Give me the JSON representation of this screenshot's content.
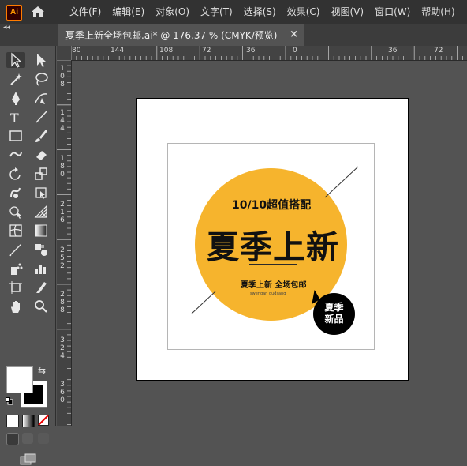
{
  "app": {
    "logo_text": "Ai"
  },
  "menu": [
    "文件(F)",
    "编辑(E)",
    "对象(O)",
    "文字(T)",
    "选择(S)",
    "效果(C)",
    "视图(V)",
    "窗口(W)",
    "帮助(H)"
  ],
  "tab": {
    "title": "夏季上新全场包邮.ai* @ 176.37 % (CMYK/预览)",
    "close": "×",
    "collapse": "◂◂"
  },
  "ruler": {
    "horizontal": [
      "80",
      "144",
      "108",
      "72",
      "36",
      "0",
      "36",
      "72"
    ],
    "vertical": [
      "1\n0\n8",
      "1\n4\n4",
      "1\n8\n0",
      "2\n1\n6",
      "2\n5\n2",
      "2\n8\n8",
      "3\n2\n4",
      "3\n6\n0"
    ]
  },
  "toolbar": {
    "tools": [
      "selection-tool",
      "direct-selection-tool",
      "magic-wand-tool",
      "lasso-tool",
      "pen-tool",
      "curvature-tool",
      "type-tool",
      "line-tool",
      "rectangle-tool",
      "paintbrush-tool",
      "shaper-tool",
      "eraser-tool",
      "rotate-tool",
      "scale-tool",
      "warp-tool",
      "free-transform-tool",
      "shape-builder-tool",
      "perspective-grid-tool",
      "mesh-tool",
      "gradient-tool",
      "eyedropper-tool",
      "blend-tool",
      "symbol-sprayer-tool",
      "column-graph-tool",
      "artboard-tool",
      "slice-tool",
      "hand-tool",
      "zoom-tool"
    ],
    "fill_color": "#ffffff",
    "stroke_color": "#000000"
  },
  "design": {
    "top_line": "10/10超值搭配",
    "headline": "夏季上新",
    "subline": "夏季上新 全场包邮",
    "pinyin": "swengan dudsang",
    "bubble_line1": "夏季",
    "bubble_line2": "新品",
    "accent_color": "#f6b42d"
  }
}
